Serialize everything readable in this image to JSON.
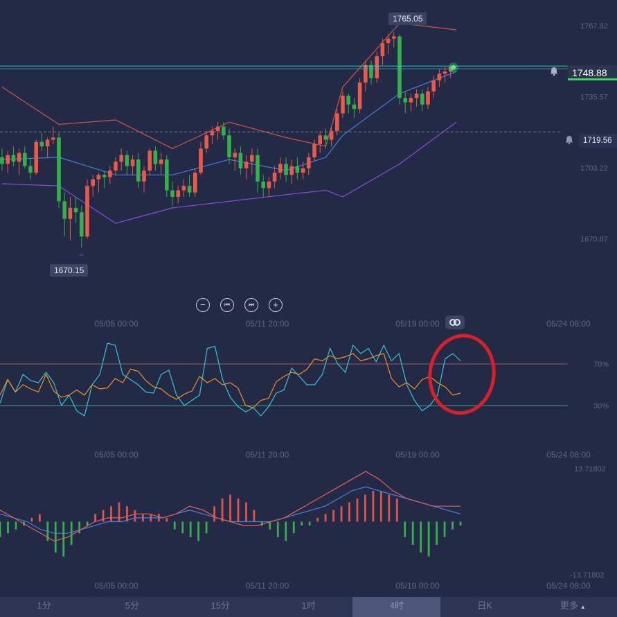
{
  "chart_data": [
    {
      "type": "candlestick",
      "title": "",
      "x_ticks": [
        "05/05 00:00",
        "05/11 20:00",
        "05/19 00:00",
        "05/24 08:00"
      ],
      "y_ticks": [
        "1767.92",
        "1735.57",
        "1703.22",
        "1670.87"
      ],
      "ylim": [
        1655,
        1772
      ],
      "current_price": "1748.88",
      "alert_price": "1719.56",
      "high_label": "1765.05",
      "low_label": "1670.15",
      "ohlc": [
        [
          1708,
          1712,
          1702,
          1705
        ],
        [
          1705,
          1711,
          1701,
          1709
        ],
        [
          1709,
          1713,
          1704,
          1706
        ],
        [
          1706,
          1712,
          1700,
          1710
        ],
        [
          1710,
          1713,
          1703,
          1704
        ],
        [
          1704,
          1708,
          1698,
          1701
        ],
        [
          1701,
          1716,
          1700,
          1715
        ],
        [
          1715,
          1719,
          1711,
          1713
        ],
        [
          1713,
          1717,
          1708,
          1716
        ],
        [
          1716,
          1722,
          1714,
          1717
        ],
        [
          1717,
          1719,
          1685,
          1688
        ],
        [
          1688,
          1692,
          1672,
          1680
        ],
        [
          1680,
          1690,
          1670,
          1685
        ],
        [
          1685,
          1690,
          1678,
          1683
        ],
        [
          1683,
          1686,
          1667,
          1672
        ],
        [
          1672,
          1698,
          1671,
          1695
        ],
        [
          1695,
          1700,
          1690,
          1698
        ],
        [
          1698,
          1701,
          1692,
          1700
        ],
        [
          1700,
          1702,
          1694,
          1699
        ],
        [
          1699,
          1704,
          1696,
          1702
        ],
        [
          1702,
          1708,
          1700,
          1706
        ],
        [
          1706,
          1712,
          1702,
          1709
        ],
        [
          1709,
          1711,
          1700,
          1704
        ],
        [
          1704,
          1709,
          1700,
          1707
        ],
        [
          1707,
          1710,
          1694,
          1697
        ],
        [
          1697,
          1704,
          1692,
          1702
        ],
        [
          1702,
          1712,
          1700,
          1711
        ],
        [
          1711,
          1713,
          1702,
          1705
        ],
        [
          1705,
          1710,
          1700,
          1707
        ],
        [
          1707,
          1709,
          1690,
          1693
        ],
        [
          1693,
          1697,
          1686,
          1690
        ],
        [
          1690,
          1695,
          1687,
          1693
        ],
        [
          1693,
          1698,
          1690,
          1695
        ],
        [
          1695,
          1700,
          1690,
          1692
        ],
        [
          1692,
          1703,
          1690,
          1701
        ],
        [
          1701,
          1715,
          1700,
          1712
        ],
        [
          1712,
          1720,
          1710,
          1718
        ],
        [
          1718,
          1722,
          1714,
          1720
        ],
        [
          1720,
          1724,
          1716,
          1722
        ],
        [
          1722,
          1724,
          1716,
          1718
        ],
        [
          1718,
          1721,
          1705,
          1708
        ],
        [
          1708,
          1712,
          1702,
          1710
        ],
        [
          1710,
          1713,
          1700,
          1703
        ],
        [
          1703,
          1709,
          1698,
          1706
        ],
        [
          1706,
          1712,
          1700,
          1709
        ],
        [
          1709,
          1712,
          1692,
          1697
        ],
        [
          1697,
          1700,
          1690,
          1694
        ],
        [
          1694,
          1699,
          1690,
          1697
        ],
        [
          1697,
          1704,
          1694,
          1701
        ],
        [
          1701,
          1708,
          1698,
          1705
        ],
        [
          1705,
          1708,
          1697,
          1700
        ],
        [
          1700,
          1707,
          1696,
          1704
        ],
        [
          1704,
          1708,
          1698,
          1701
        ],
        [
          1701,
          1706,
          1698,
          1703
        ],
        [
          1703,
          1710,
          1700,
          1708
        ],
        [
          1708,
          1716,
          1706,
          1714
        ],
        [
          1714,
          1720,
          1710,
          1718
        ],
        [
          1718,
          1721,
          1712,
          1716
        ],
        [
          1716,
          1722,
          1713,
          1720
        ],
        [
          1720,
          1730,
          1718,
          1728
        ],
        [
          1728,
          1738,
          1726,
          1736
        ],
        [
          1736,
          1737,
          1728,
          1732
        ],
        [
          1732,
          1735,
          1726,
          1730
        ],
        [
          1730,
          1744,
          1728,
          1742
        ],
        [
          1742,
          1752,
          1738,
          1750
        ],
        [
          1750,
          1752,
          1741,
          1744
        ],
        [
          1744,
          1756,
          1742,
          1754
        ],
        [
          1754,
          1762,
          1750,
          1760
        ],
        [
          1760,
          1764,
          1755,
          1762
        ],
        [
          1762,
          1765,
          1758,
          1763
        ],
        [
          1763,
          1764,
          1732,
          1735
        ],
        [
          1735,
          1738,
          1728,
          1733
        ],
        [
          1733,
          1737,
          1729,
          1735
        ],
        [
          1735,
          1739,
          1731,
          1737
        ],
        [
          1737,
          1739,
          1729,
          1732
        ],
        [
          1732,
          1740,
          1730,
          1738
        ],
        [
          1738,
          1745,
          1735,
          1743
        ],
        [
          1743,
          1748,
          1740,
          1746
        ],
        [
          1746,
          1749,
          1742,
          1747
        ],
        [
          1747,
          1750,
          1744,
          1749
        ]
      ],
      "bollinger": {
        "upper": [
          [
            0,
            1740
          ],
          [
            10,
            1723
          ],
          [
            20,
            1725
          ],
          [
            30,
            1712
          ],
          [
            40,
            1724
          ],
          [
            50,
            1717
          ],
          [
            57,
            1713
          ],
          [
            60,
            1740
          ],
          [
            70,
            1769
          ],
          [
            80,
            1766
          ]
        ],
        "middle": [
          [
            0,
            1707
          ],
          [
            10,
            1708
          ],
          [
            20,
            1700
          ],
          [
            30,
            1700
          ],
          [
            40,
            1707
          ],
          [
            50,
            1702
          ],
          [
            57,
            1708
          ],
          [
            60,
            1718
          ],
          [
            70,
            1737
          ],
          [
            80,
            1747
          ]
        ],
        "lower": [
          [
            0,
            1696
          ],
          [
            10,
            1695
          ],
          [
            20,
            1678
          ],
          [
            30,
            1685
          ],
          [
            40,
            1688
          ],
          [
            50,
            1691
          ],
          [
            57,
            1693
          ],
          [
            60,
            1690
          ],
          [
            70,
            1705
          ],
          [
            80,
            1724
          ]
        ]
      }
    },
    {
      "type": "line",
      "title": "",
      "y_labels": [
        "70%",
        "30%"
      ],
      "ylim": [
        0,
        100
      ],
      "x_ticks": [
        "05/05 00:00",
        "05/11 20:00",
        "05/19 00:00",
        "05/24 08:00"
      ],
      "series": [
        {
          "color": "#2fc7d9",
          "values": [
            32,
            55,
            43,
            60,
            54,
            52,
            62,
            52,
            30,
            40,
            25,
            20,
            50,
            60,
            90,
            88,
            60,
            55,
            50,
            43,
            42,
            60,
            64,
            40,
            30,
            35,
            40,
            85,
            87,
            55,
            38,
            29,
            24,
            28,
            20,
            29,
            42,
            45,
            66,
            58,
            50,
            50,
            60,
            85,
            70,
            62,
            88,
            80,
            85,
            72,
            88,
            73,
            80,
            50,
            35,
            25,
            30,
            40,
            75,
            80,
            73
          ]
        },
        {
          "color": "#f7911e",
          "values": [
            40,
            55,
            43,
            50,
            46,
            43,
            60,
            44,
            38,
            40,
            45,
            40,
            50,
            46,
            47,
            56,
            52,
            65,
            63,
            54,
            48,
            46,
            40,
            36,
            41,
            44,
            58,
            52,
            56,
            50,
            52,
            47,
            30,
            28,
            35,
            37,
            53,
            58,
            62,
            60,
            65,
            75,
            73,
            78,
            75,
            77,
            80,
            73,
            75,
            78,
            80,
            56,
            48,
            52,
            46,
            55,
            58,
            52,
            48,
            40,
            42
          ]
        }
      ]
    },
    {
      "type": "bar",
      "title": "",
      "y_labels": [
        "13.71802",
        "-13.71802"
      ],
      "ylim": [
        -13.71802,
        13.71802
      ],
      "x_ticks": [
        "05/05 00:00",
        "05/11 20:00",
        "05/19 00:00",
        "05/24 08:00"
      ],
      "histogram": [
        -4,
        -3,
        -2,
        -1,
        1,
        2,
        -5,
        -8,
        -9,
        -6,
        -3,
        -1,
        2,
        3,
        4,
        5,
        4,
        3,
        2,
        2,
        2,
        1,
        -2,
        -3,
        -4,
        -5,
        -3,
        4,
        6,
        7,
        6,
        5,
        3,
        -1,
        -2,
        -4,
        -5,
        -3,
        -1,
        -1,
        1,
        2,
        3,
        4,
        5,
        6,
        7,
        8,
        8,
        7,
        6,
        -4,
        -6,
        -8,
        -9,
        -6,
        -4,
        -2,
        -1
      ],
      "series": [
        {
          "color": "#4a7ee6",
          "values": [
            2,
            1,
            0,
            -2,
            -3,
            -3,
            -2,
            -1,
            0,
            0,
            1,
            1,
            1,
            2,
            3,
            2,
            1,
            0,
            0,
            0,
            0,
            1,
            2,
            3,
            4,
            6,
            8,
            9,
            8,
            7,
            6,
            5,
            4,
            3,
            2
          ]
        },
        {
          "color": "#ed5f53",
          "values": [
            3,
            1,
            -1,
            -3,
            -5,
            -4,
            -2,
            0,
            1,
            1,
            2,
            2,
            1,
            2,
            4,
            3,
            1,
            0,
            -1,
            -1,
            0,
            1,
            3,
            5,
            7,
            9,
            11,
            13,
            11,
            8,
            6,
            5,
            4,
            4,
            4
          ]
        }
      ]
    }
  ],
  "controls": {
    "zoom_out": "−",
    "prev": "⏮",
    "next": "⏭",
    "zoom_in": "+"
  },
  "timeframes": [
    {
      "label": "1分",
      "active": false
    },
    {
      "label": "5分",
      "active": false
    },
    {
      "label": "15分",
      "active": false
    },
    {
      "label": "1时",
      "active": false
    },
    {
      "label": "4时",
      "active": true
    },
    {
      "label": "日K",
      "active": false
    },
    {
      "label": "更多",
      "active": false
    }
  ],
  "icons": {
    "alert": "bell-icon",
    "more": "caret-up-icon",
    "toggle": "infinity-icon"
  },
  "colors": {
    "up": "#ea5a4a",
    "down": "#35b04a",
    "bb_upper": "#d9533f",
    "bb_mid": "#3f7fe0",
    "bb_lower": "#8a4de0",
    "price_line": "#2fd3c7",
    "annotation": "#d7202a"
  }
}
